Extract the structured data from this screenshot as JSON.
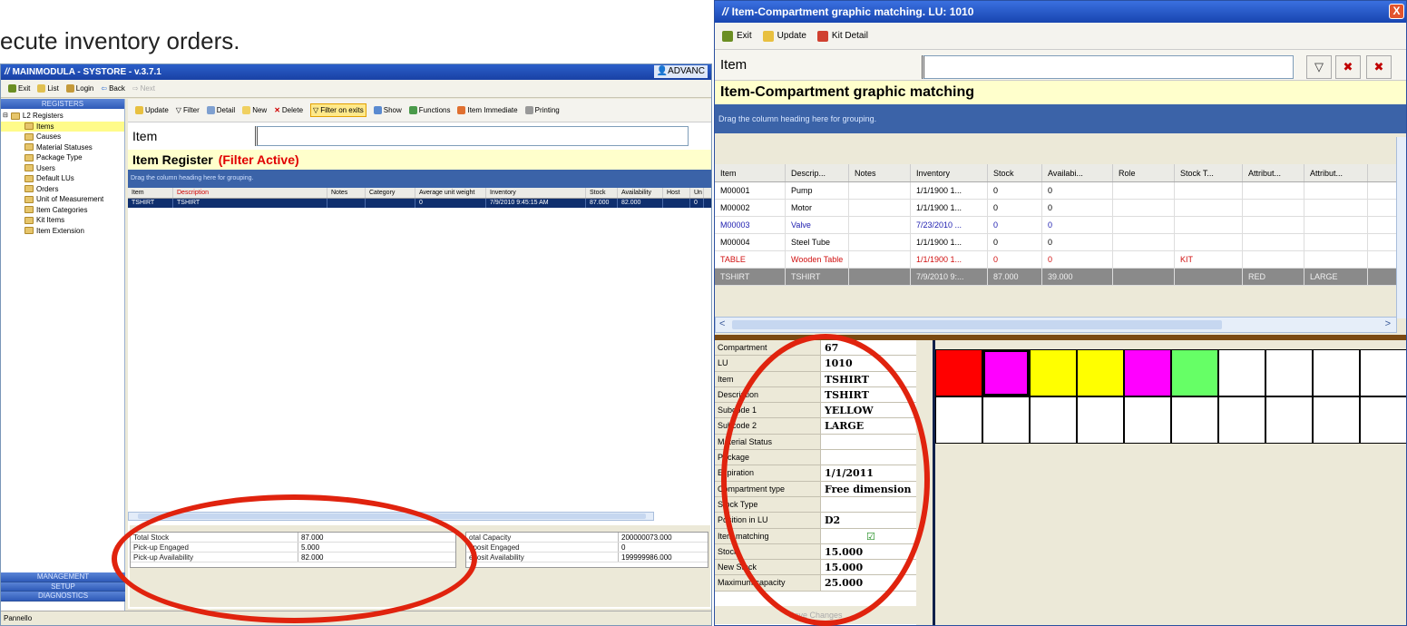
{
  "slide_text": "ecute inventory orders.",
  "left_window": {
    "title": "MAINMODULA - SYSTORE - v.3.7.1",
    "user": "ADVANC",
    "toolbar": [
      "Exit",
      "List",
      "Login",
      "Back",
      "Next"
    ],
    "nav_header": "REGISTERS",
    "tree_root": "L2 Registers",
    "tree_items": [
      "Items",
      "Causes",
      "Material Statuses",
      "Package Type",
      "Users",
      "Default LUs",
      "Orders",
      "Unit of Measurement",
      "Item Categories",
      "Kit Items",
      "Item Extension"
    ],
    "nav_bottom": [
      "MANAGEMENT",
      "SETUP",
      "DIAGNOSTICS"
    ],
    "status": "Pannello",
    "main_toolbar": [
      "Update",
      "Filter",
      "Detail",
      "New",
      "Delete",
      "Filter on exits",
      "Show",
      "Functions",
      "Item Immediate",
      "Printing"
    ],
    "search_label": "Item",
    "register_title": "Item Register",
    "filter_flag": "(Filter Active)",
    "drag_hint": "Drag the column heading here for grouping.",
    "columns": [
      "Item",
      "Description",
      "Notes",
      "Category",
      "Average unit weight",
      "Inventory",
      "Stock",
      "Availability",
      "Host",
      "Un"
    ],
    "row": [
      "TSHIRT",
      "TSHIRT",
      "",
      "",
      "0",
      "7/9/2010 9:45:15 AM",
      "87.000",
      "82.000",
      "",
      "0"
    ],
    "stats_left": [
      {
        "label": "Total Stock",
        "value": "87.000"
      },
      {
        "label": "Pick-up Engaged",
        "value": "5.000"
      },
      {
        "label": "Pick-up Availability",
        "value": "82.000"
      }
    ],
    "stats_right": [
      {
        "label": "otal Capacity",
        "value": "200000073.000"
      },
      {
        "label": "eposit Engaged",
        "value": "0"
      },
      {
        "label": "eposit Availability",
        "value": "199999986.000"
      }
    ]
  },
  "right_window": {
    "title": "Item-Compartment graphic matching. LU: 1010",
    "close": "X",
    "toolbar": [
      "Exit",
      "Update",
      "Kit Detail"
    ],
    "search_label": "Item",
    "filter_icons": [
      "▽",
      "✖",
      "✖"
    ],
    "main_title": "Item-Compartment graphic matching",
    "drag_hint": "Drag the column heading here for grouping.",
    "columns": [
      "Item",
      "Descrip...",
      "Notes",
      "Inventory",
      "Stock",
      "Availabi...",
      "Role",
      "Stock T...",
      "Attribut...",
      "Attribut..."
    ],
    "rows": [
      {
        "cells": [
          "M00001",
          "Pump",
          "",
          "1/1/1900 1...",
          "0",
          "0",
          "",
          "",
          "",
          ""
        ],
        "color": "#000"
      },
      {
        "cells": [
          "M00002",
          "Motor",
          "",
          "1/1/1900 1...",
          "0",
          "0",
          "",
          "",
          "",
          ""
        ],
        "color": "#000"
      },
      {
        "cells": [
          "M00003",
          "Valve",
          "",
          "7/23/2010 ...",
          "0",
          "0",
          "",
          "",
          "",
          ""
        ],
        "color": "#2020b0"
      },
      {
        "cells": [
          "M00004",
          "Steel Tube",
          "",
          "1/1/1900 1...",
          "0",
          "0",
          "",
          "",
          "",
          ""
        ],
        "color": "#000"
      },
      {
        "cells": [
          "TABLE",
          "Wooden Table",
          "",
          "1/1/1900 1...",
          "0",
          "0",
          "",
          "KIT",
          "",
          ""
        ],
        "color": "#d01010"
      },
      {
        "cells": [
          "TSHIRT",
          "TSHIRT",
          "",
          "7/9/2010 9:...",
          "87.000",
          "39.000",
          "",
          "",
          "RED",
          "LARGE"
        ],
        "color": "sel"
      }
    ],
    "properties": [
      {
        "label": "Compartment",
        "value": "67"
      },
      {
        "label": "LU",
        "value": "1010"
      },
      {
        "label": "Item",
        "value": "TSHIRT"
      },
      {
        "label": "Description",
        "value": "TSHIRT"
      },
      {
        "label": "Subcode 1",
        "value": "YELLOW"
      },
      {
        "label": "Subcode 2",
        "value": "LARGE"
      },
      {
        "label": "Material Status",
        "value": ""
      },
      {
        "label": "Package",
        "value": ""
      },
      {
        "label": "Expiration",
        "value": "1/1/2011"
      },
      {
        "label": "Compartment type",
        "value": "Free dimension"
      },
      {
        "label": "Stock Type",
        "value": ""
      },
      {
        "label": "Position in LU",
        "value": "D2"
      },
      {
        "label": "Item matching",
        "value": "☑"
      },
      {
        "label": "Stock",
        "value": "15.000"
      },
      {
        "label": "New Stock",
        "value": "15.000"
      },
      {
        "label": "Maximum capacity",
        "value": "25.000"
      }
    ],
    "save_label": "Save Changes",
    "compartments_row1": [
      "#ff0000",
      "#ff00ff",
      "#ffff00",
      "#ffff00",
      "#ff00ff",
      "#66ff66",
      "#ffffff",
      "#ffffff",
      "#ffffff",
      "#ffffff"
    ],
    "compartments_row2": [
      "#ffffff",
      "#ffffff",
      "#ffffff",
      "#ffffff",
      "#ffffff",
      "#ffffff",
      "#ffffff",
      "#ffffff",
      "#ffffff",
      "#ffffff"
    ],
    "selected_compartment": "67"
  }
}
